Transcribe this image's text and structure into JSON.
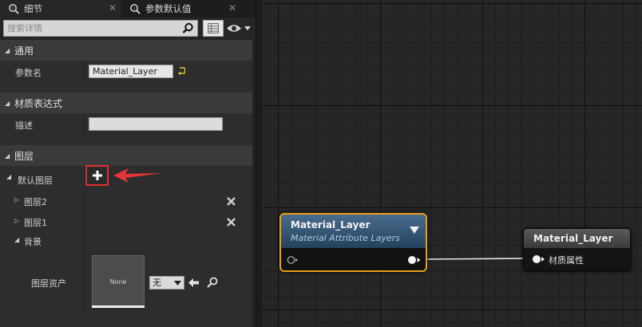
{
  "tabs": [
    {
      "label": "细节",
      "active": true
    },
    {
      "label": "参数默认值",
      "active": false
    }
  ],
  "search": {
    "placeholder": "搜索详情"
  },
  "categories": {
    "general": "通用",
    "material_expression": "材质表达式",
    "layers": "图层"
  },
  "properties": {
    "param_name_label": "参数名",
    "param_name_value": "Material_Layer",
    "description_label": "描述",
    "description_value": ""
  },
  "layers_tree": {
    "default_layers": "默认图层",
    "layer2": "图层2",
    "layer1": "图层1",
    "background": "背景",
    "layer_asset_label": "图层资产",
    "thumbnail_text": "None",
    "asset_combo_value": "无"
  },
  "graph": {
    "node_layer": {
      "title": "Material_Layer",
      "subtitle": "Material Attribute Layers"
    },
    "node_output": {
      "title": "Material_Layer",
      "pin_label": "材质属性"
    }
  },
  "colors": {
    "accent_selection": "#e8a017",
    "highlight_red": "#e03030",
    "node_header_blue": "#4a6d8e"
  },
  "icons": [
    "tab-details-icon",
    "tab-defaults-icon",
    "close-icon",
    "search-icon",
    "grid-view-icon",
    "eye-icon",
    "reset-arrow-icon",
    "add-icon",
    "remove-icon",
    "use-selected-icon",
    "browse-icon"
  ]
}
